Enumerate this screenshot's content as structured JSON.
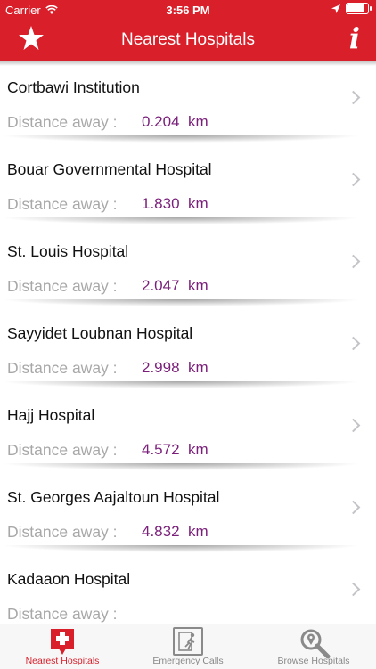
{
  "status": {
    "carrier": "Carrier",
    "time": "3:56 PM",
    "battery": 0.95
  },
  "navbar": {
    "title": "Nearest Hospitals",
    "left_icon": "star-icon",
    "right_icon": "info-icon",
    "info_glyph": "i"
  },
  "hospitals": [
    {
      "name": "Cortbawi Institution",
      "label": "Distance away :",
      "distance": "0.204",
      "unit": "km"
    },
    {
      "name": "Bouar Governmental Hospital",
      "label": "Distance away :",
      "distance": "1.830",
      "unit": "km"
    },
    {
      "name": "St. Louis Hospital",
      "label": "Distance away :",
      "distance": "2.047",
      "unit": "km"
    },
    {
      "name": "Sayyidet Loubnan Hospital",
      "label": "Distance away :",
      "distance": "2.998",
      "unit": "km"
    },
    {
      "name": "Hajj Hospital",
      "label": "Distance away :",
      "distance": "4.572",
      "unit": "km"
    },
    {
      "name": "St. Georges Aajaltoun Hospital",
      "label": "Distance away :",
      "distance": "4.832",
      "unit": "km"
    },
    {
      "name": "Kadaaon Hospital",
      "label": "Distance away :",
      "distance": "",
      "unit": ""
    }
  ],
  "tabs": [
    {
      "label": "Nearest Hospitals",
      "icon": "hospital-cross-icon",
      "active": true
    },
    {
      "label": "Emergency Calls",
      "icon": "emergency-exit-icon",
      "active": false
    },
    {
      "label": "Browse Hospitals",
      "icon": "magnifier-location-icon",
      "active": false
    }
  ],
  "colors": {
    "brand": "#d81f2a",
    "distance": "#7a1f7a",
    "muted": "#a8a8a8"
  }
}
